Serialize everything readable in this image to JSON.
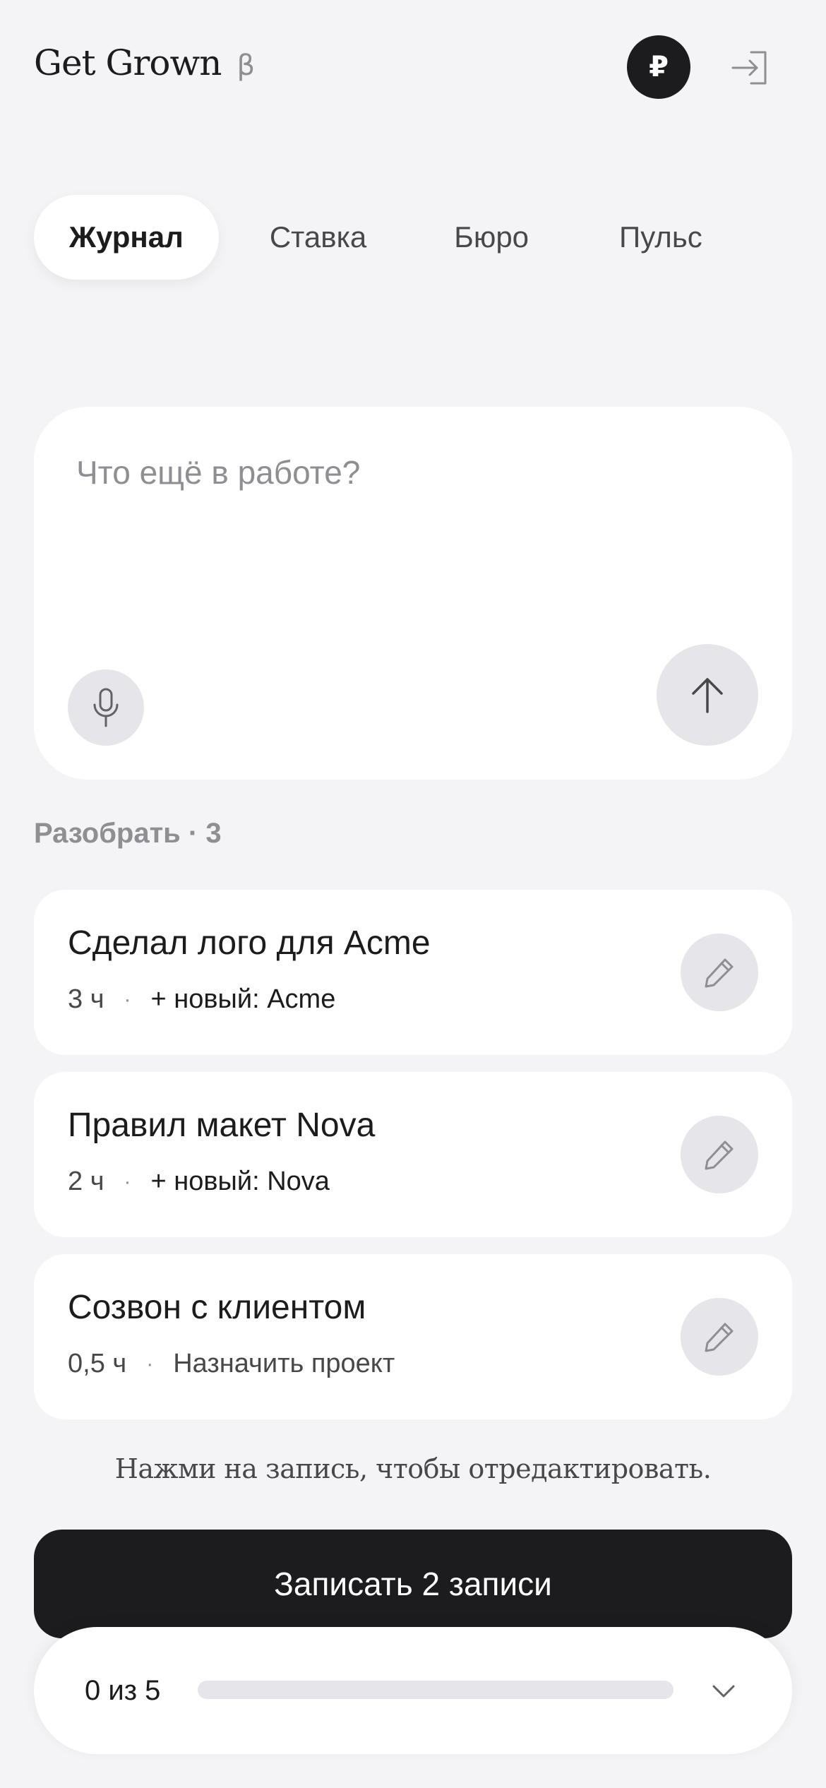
{
  "header": {
    "app_title": "Get Grown",
    "beta_badge": "β",
    "currency_symbol": "₽",
    "icons": {
      "currency": "ruble-icon",
      "login": "login-icon"
    }
  },
  "tabs": [
    {
      "label": "Журнал",
      "active": true
    },
    {
      "label": "Ставка",
      "active": false
    },
    {
      "label": "Бюро",
      "active": false
    },
    {
      "label": "Пульс",
      "active": false
    }
  ],
  "composer": {
    "placeholder": "Что ещё в работе?",
    "value": "",
    "icons": {
      "mic": "microphone-icon",
      "send": "arrow-up-icon"
    }
  },
  "section": {
    "label": "Разобрать · 3"
  },
  "entries": [
    {
      "title": "Сделал лого для Acme",
      "hours": "3 ч",
      "separator": "·",
      "tag": "+ новый: Acme",
      "tag_kind": "new-client",
      "icon": "pencil-icon"
    },
    {
      "title": "Правил макет Nova",
      "hours": "2 ч",
      "separator": "·",
      "tag": "+ новый: Nova",
      "tag_kind": "new-client",
      "icon": "pencil-icon"
    },
    {
      "title": "Созвон с клиентом",
      "hours": "0,5 ч",
      "separator": "·",
      "tag": "Назначить проект",
      "tag_kind": "assign-project",
      "icon": "pencil-icon"
    }
  ],
  "hint": "Нажми на запись, чтобы отредактировать.",
  "submit": {
    "label": "Записать 2 записи"
  },
  "progress": {
    "label": "0 из 5",
    "done": 0,
    "total": 5,
    "icon": "chevron-down-icon"
  },
  "colors": {
    "background": "#f4f4f6",
    "dark": "#1c1c1e",
    "muted": "#8e8e93",
    "chip": "#e5e5ea"
  }
}
